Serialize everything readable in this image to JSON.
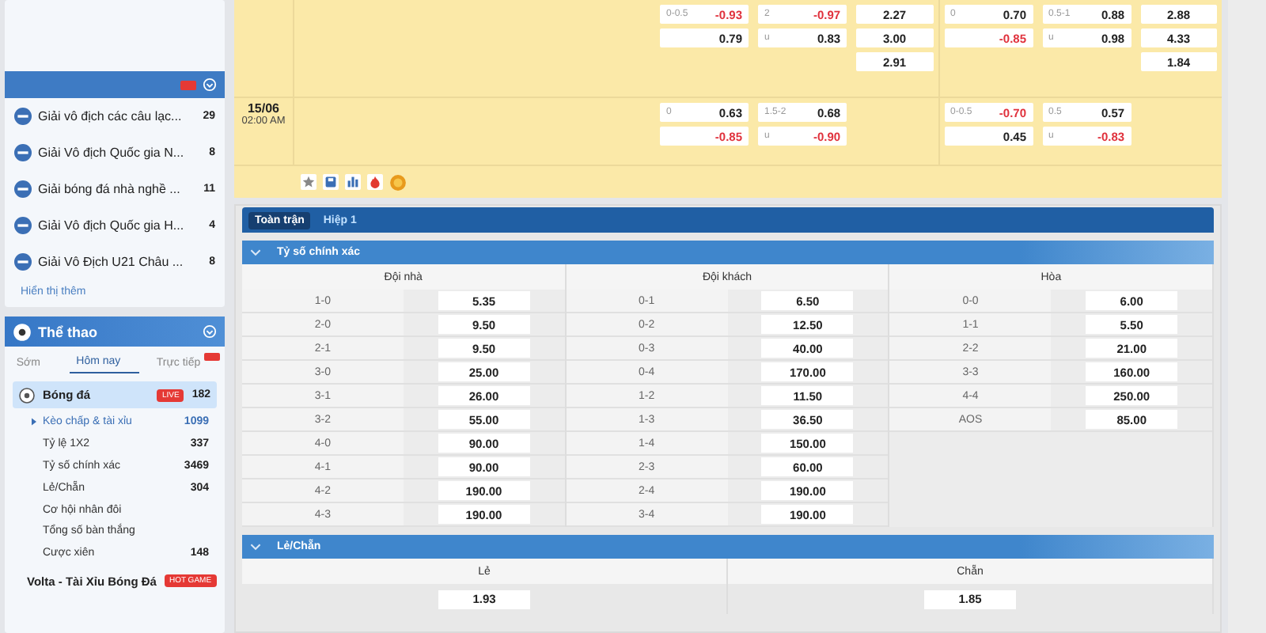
{
  "sidebar": {
    "leagues": [
      {
        "name": "Giải vô địch các câu lạc...",
        "count": "29"
      },
      {
        "name": "Giải Vô địch Quốc gia N...",
        "count": "8"
      },
      {
        "name": "Giải bóng đá nhà nghề ...",
        "count": "11"
      },
      {
        "name": "Giải Vô địch Quốc gia H...",
        "count": "4"
      },
      {
        "name": "Giải Vô Địch U21 Châu ...",
        "count": "8"
      }
    ],
    "show_more": "Hiển thị thêm",
    "sports_panel": {
      "title": "Thể thao",
      "tabs": [
        {
          "label": "Sớm",
          "selected": false,
          "badge": false
        },
        {
          "label": "Hôm nay",
          "selected": true,
          "badge": false
        },
        {
          "label": "Trực tiếp",
          "selected": false,
          "badge": true
        }
      ],
      "sports": [
        {
          "name": "Bóng đá",
          "badge": "LIVE",
          "count": "182",
          "selected": true,
          "children": [
            {
              "label": "Kèo chấp & tài xỉu",
              "count": "1099",
              "selected": true
            },
            {
              "label": "Tỷ lệ 1X2",
              "count": "337",
              "selected": false
            },
            {
              "label": "Tỷ số chính xác",
              "count": "3469",
              "selected": false
            },
            {
              "label": "Lẻ/Chẵn",
              "count": "304",
              "selected": false
            },
            {
              "label": "Cơ hội nhân đôi",
              "selected": false
            },
            {
              "label": "Tổng số bàn thắng",
              "selected": false
            },
            {
              "label": "Cược xiên",
              "count": "148",
              "selected": false
            }
          ]
        },
        {
          "name": "Volta - Tài Xỉu Bóng Đá",
          "badge": "HOT GAME",
          "selected": false
        }
      ]
    }
  },
  "match_odds": [
    {
      "markets": [
        {
          "kind": "pair",
          "cells": [
            {
              "line": "0-0.5",
              "odds": "-0.93",
              "negative": true
            },
            {
              "odds": "0.79",
              "negative": false
            }
          ]
        },
        {
          "kind": "pair",
          "cells": [
            {
              "line": "2",
              "odds": "-0.97",
              "negative": true
            },
            {
              "line": "u",
              "odds": "0.83",
              "negative": false
            }
          ]
        },
        {
          "kind": "triple",
          "cells": [
            {
              "odds": "2.27",
              "negative": false
            },
            {
              "odds": "3.00",
              "negative": false
            },
            {
              "odds": "2.91",
              "negative": false
            }
          ]
        },
        {
          "kind": "pair",
          "cells": [
            {
              "line": "0",
              "odds": "0.70",
              "negative": false
            },
            {
              "odds": "-0.85",
              "negative": true
            }
          ]
        },
        {
          "kind": "pair",
          "cells": [
            {
              "line": "0.5-1",
              "odds": "0.88",
              "negative": false
            },
            {
              "line": "u",
              "odds": "0.98",
              "negative": false
            }
          ]
        },
        {
          "kind": "triple",
          "cells": [
            {
              "odds": "2.88",
              "negative": false
            },
            {
              "odds": "4.33",
              "negative": false
            },
            {
              "odds": "1.84",
              "negative": false
            }
          ]
        }
      ]
    },
    {
      "date": "15/06",
      "time": "02:00 AM",
      "markets": [
        {
          "kind": "pair",
          "cells": [
            {
              "line": "0",
              "odds": "0.63",
              "negative": false
            },
            {
              "odds": "-0.85",
              "negative": true
            }
          ]
        },
        {
          "kind": "pair",
          "cells": [
            {
              "line": "1.5-2",
              "odds": "0.68",
              "negative": false
            },
            {
              "line": "u",
              "odds": "-0.90",
              "negative": true
            }
          ]
        },
        {
          "kind": "empty"
        },
        {
          "kind": "pair",
          "cells": [
            {
              "line": "0-0.5",
              "odds": "-0.70",
              "negative": true
            },
            {
              "odds": "0.45",
              "negative": false
            }
          ]
        },
        {
          "kind": "pair",
          "cells": [
            {
              "line": "0.5",
              "odds": "0.57",
              "negative": false
            },
            {
              "line": "u",
              "odds": "-0.83",
              "negative": true
            }
          ]
        },
        {
          "kind": "empty"
        }
      ]
    }
  ],
  "period_tabs": [
    {
      "label": "Toàn trận",
      "selected": true
    },
    {
      "label": "Hiệp 1",
      "selected": false
    }
  ],
  "markets": [
    {
      "kind": "correct_score",
      "title": "Tỷ số chính xác",
      "expanded": true,
      "columns": [
        {
          "heading": "Đội nhà",
          "rows": [
            {
              "score": "1-0",
              "odds": "5.35"
            },
            {
              "score": "2-0",
              "odds": "9.50"
            },
            {
              "score": "2-1",
              "odds": "9.50"
            },
            {
              "score": "3-0",
              "odds": "25.00"
            },
            {
              "score": "3-1",
              "odds": "26.00"
            },
            {
              "score": "3-2",
              "odds": "55.00"
            },
            {
              "score": "4-0",
              "odds": "90.00"
            },
            {
              "score": "4-1",
              "odds": "90.00"
            },
            {
              "score": "4-2",
              "odds": "190.00"
            },
            {
              "score": "4-3",
              "odds": "190.00"
            }
          ]
        },
        {
          "heading": "Đội khách",
          "rows": [
            {
              "score": "0-1",
              "odds": "6.50"
            },
            {
              "score": "0-2",
              "odds": "12.50"
            },
            {
              "score": "0-3",
              "odds": "40.00"
            },
            {
              "score": "0-4",
              "odds": "170.00"
            },
            {
              "score": "1-2",
              "odds": "11.50"
            },
            {
              "score": "1-3",
              "odds": "36.50"
            },
            {
              "score": "1-4",
              "odds": "150.00"
            },
            {
              "score": "2-3",
              "odds": "60.00"
            },
            {
              "score": "2-4",
              "odds": "190.00"
            },
            {
              "score": "3-4",
              "odds": "190.00"
            }
          ]
        },
        {
          "heading": "Hòa",
          "rows": [
            {
              "score": "0-0",
              "odds": "6.00"
            },
            {
              "score": "1-1",
              "odds": "5.50"
            },
            {
              "score": "2-2",
              "odds": "21.00"
            },
            {
              "score": "3-3",
              "odds": "160.00"
            },
            {
              "score": "4-4",
              "odds": "250.00"
            },
            {
              "score": "AOS",
              "odds": "85.00"
            }
          ]
        }
      ]
    },
    {
      "kind": "odd_even",
      "title": "Lẻ/Chẵn",
      "expanded": true,
      "columns": [
        {
          "heading": "Lẻ",
          "odds": "1.93"
        },
        {
          "heading": "Chẵn",
          "odds": "1.85"
        }
      ]
    }
  ]
}
